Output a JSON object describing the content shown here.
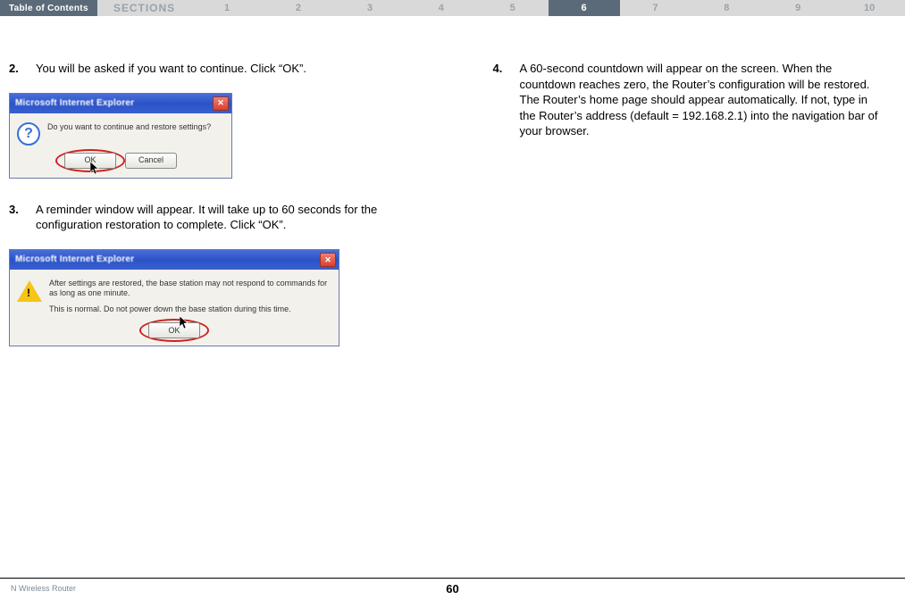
{
  "topbar": {
    "toc_label": "Table of Contents",
    "sections_label": "SECTIONS",
    "sections": [
      "1",
      "2",
      "3",
      "4",
      "5",
      "6",
      "7",
      "8",
      "9",
      "10"
    ],
    "active_section": "6"
  },
  "left_column": {
    "step2": {
      "num": "2.",
      "text": "You will be asked if you want to continue. Click “OK”."
    },
    "dialog1": {
      "title": "Microsoft Internet Explorer",
      "message": "Do you want to continue and restore settings?",
      "ok_label": "OK",
      "cancel_label": "Cancel"
    },
    "step3": {
      "num": "3.",
      "text": "A reminder window will appear. It will take up to 60 seconds for the configuration restoration to complete. Click “OK”."
    },
    "dialog2": {
      "title": "Microsoft Internet Explorer",
      "line1": "After settings are restored, the base station may not respond to commands for as long as one minute.",
      "line2": "This is normal. Do not power down the base station during this time.",
      "ok_label": "OK"
    }
  },
  "right_column": {
    "step4": {
      "num": "4.",
      "text": "A 60-second countdown will appear on the screen. When the countdown reaches zero, the Router’s configuration will be restored. The Router’s home page should appear automatically. If not, type in the Router’s address (default = 192.168.2.1) into the navigation bar of your browser."
    }
  },
  "footer": {
    "product": "N Wireless Router",
    "page": "60"
  }
}
